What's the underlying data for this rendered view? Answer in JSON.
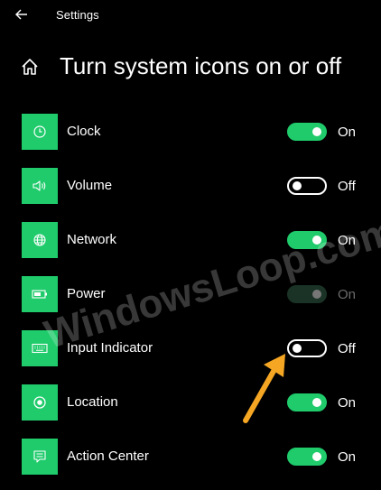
{
  "window": {
    "title": "Settings"
  },
  "header": {
    "page_title": "Turn system icons on or off"
  },
  "rows": [
    {
      "label": "Clock",
      "state": "On",
      "icon": "clock-icon"
    },
    {
      "label": "Volume",
      "state": "Off",
      "icon": "volume-icon"
    },
    {
      "label": "Network",
      "state": "On",
      "icon": "globe-icon"
    },
    {
      "label": "Power",
      "state": "On",
      "icon": "battery-icon"
    },
    {
      "label": "Input Indicator",
      "state": "Off",
      "icon": "keyboard-icon"
    },
    {
      "label": "Location",
      "state": "On",
      "icon": "location-icon"
    },
    {
      "label": "Action Center",
      "state": "On",
      "icon": "action-center-icon"
    }
  ],
  "watermark": "WindowsLoop.com",
  "colors": {
    "accent": "#1fcb6b",
    "arrow": "#f5a623",
    "background": "#000000"
  }
}
